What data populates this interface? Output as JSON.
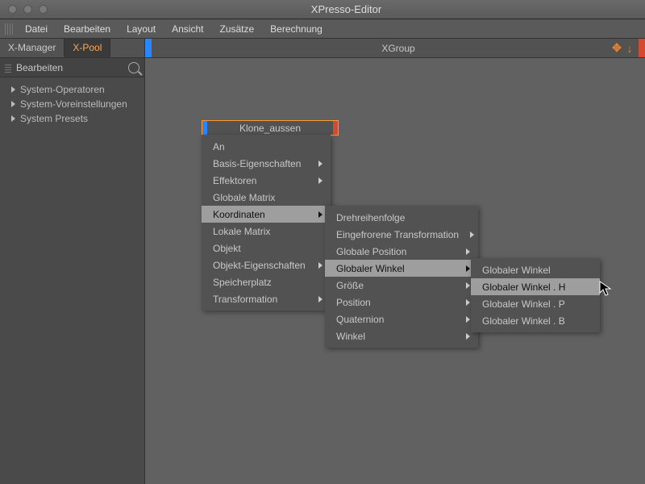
{
  "window": {
    "title": "XPresso-Editor"
  },
  "menubar": [
    "Datei",
    "Bearbeiten",
    "Layout",
    "Ansicht",
    "Zusätze",
    "Berechnung"
  ],
  "sidebar": {
    "tabs": [
      "X-Manager",
      "X-Pool"
    ],
    "toolbar_label": "Bearbeiten",
    "tree": [
      "System-Operatoren",
      "System-Voreinstellungen",
      "System Presets"
    ]
  },
  "group_header": "XGroup",
  "node_title": "Klone_aussen",
  "menu1": [
    {
      "label": "An",
      "arrow": false
    },
    {
      "label": "Basis-Eigenschaften",
      "arrow": true
    },
    {
      "label": "Effektoren",
      "arrow": true
    },
    {
      "label": "Globale Matrix",
      "arrow": false
    },
    {
      "label": "Koordinaten",
      "arrow": true,
      "hl": true
    },
    {
      "label": "Lokale Matrix",
      "arrow": false
    },
    {
      "label": "Objekt",
      "arrow": false
    },
    {
      "label": "Objekt-Eigenschaften",
      "arrow": true
    },
    {
      "label": "Speicherplatz",
      "arrow": false
    },
    {
      "label": "Transformation",
      "arrow": true
    }
  ],
  "menu2": [
    {
      "label": "Drehreihenfolge",
      "arrow": false
    },
    {
      "label": "Eingefrorene Transformation",
      "arrow": true
    },
    {
      "label": "Globale Position",
      "arrow": true
    },
    {
      "label": "Globaler Winkel",
      "arrow": true,
      "hl": true
    },
    {
      "label": "Größe",
      "arrow": true
    },
    {
      "label": "Position",
      "arrow": true
    },
    {
      "label": "Quaternion",
      "arrow": true
    },
    {
      "label": "Winkel",
      "arrow": true
    }
  ],
  "menu3": [
    {
      "label": "Globaler Winkel",
      "arrow": false
    },
    {
      "label": "Globaler Winkel . H",
      "arrow": false,
      "hl": true
    },
    {
      "label": "Globaler Winkel . P",
      "arrow": false
    },
    {
      "label": "Globaler Winkel . B",
      "arrow": false
    }
  ]
}
